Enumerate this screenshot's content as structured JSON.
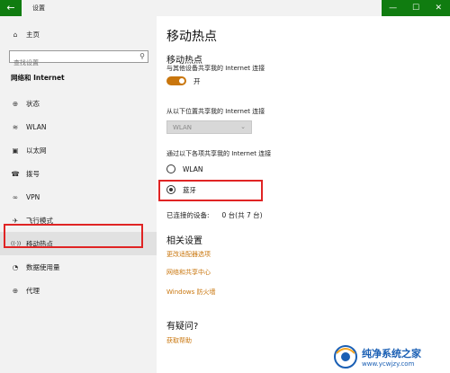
{
  "window": {
    "title": "设置",
    "back": "←",
    "controls": [
      "—",
      "☐",
      "✕"
    ]
  },
  "sidebar": {
    "home": {
      "icon": "⌂",
      "label": "主页"
    },
    "search": {
      "placeholder": "查找设置",
      "icon": "⚲"
    },
    "section_title": "网络和 Internet",
    "items": [
      {
        "icon": "⊕",
        "label": "状态"
      },
      {
        "icon": "≋",
        "label": "WLAN"
      },
      {
        "icon": "▣",
        "label": "以太网"
      },
      {
        "icon": "☎",
        "label": "拨号"
      },
      {
        "icon": "∞",
        "label": "VPN"
      },
      {
        "icon": "✈",
        "label": "飞行模式"
      },
      {
        "icon": "((·))",
        "label": "移动热点"
      },
      {
        "icon": "◔",
        "label": "数据使用量"
      },
      {
        "icon": "⊕",
        "label": "代理"
      }
    ]
  },
  "main": {
    "title": "移动热点",
    "subheading": "移动热点",
    "share_desc": "与其他设备共享我的 Internet 连接",
    "toggle": {
      "state": "开",
      "on": true
    },
    "share_from_label": "从以下位置共享我的 Internet 连接",
    "share_from_value": "WLAN",
    "share_over_label": "通过以下各项共享我的 Internet 连接",
    "radio_options": [
      {
        "label": "WLAN",
        "checked": false
      },
      {
        "label": "蓝牙",
        "checked": true
      }
    ],
    "devices": {
      "label": "已连接的设备:",
      "value": "0 台(共 7 台)"
    },
    "related": {
      "title": "相关设置",
      "links": [
        "更改适配器选项",
        "网络和共享中心",
        "Windows 防火墙"
      ]
    },
    "qa": {
      "title": "有疑问?",
      "link": "获取帮助"
    }
  },
  "watermark": {
    "name": "纯净系统之家",
    "url": "www.ycwjzy.com"
  },
  "colors": {
    "accent": "#107c10",
    "toggle": "#c9760d",
    "link": "#c9760d",
    "highlight": "#e02424"
  }
}
